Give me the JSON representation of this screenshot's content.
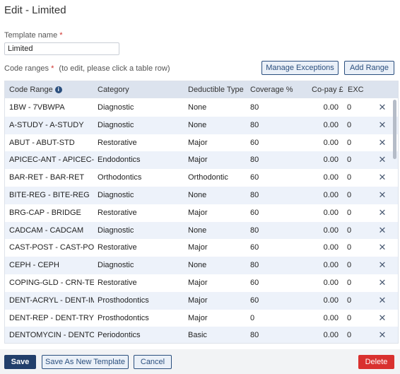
{
  "page": {
    "title": "Edit - Limited"
  },
  "template_name": {
    "label": "Template name",
    "required_mark": "*",
    "value": "Limited"
  },
  "code_ranges": {
    "label": "Code ranges",
    "required_mark": "*",
    "hint": "(to edit, please click a table row)",
    "manage_exceptions_label": "Manage Exceptions",
    "add_range_label": "Add Range"
  },
  "table": {
    "columns": {
      "code_range": "Code Range",
      "category": "Category",
      "deductible_type": "Deductible Type",
      "coverage": "Coverage %",
      "copay": "Co-pay £",
      "exc": "EXC"
    },
    "info_icon": "info-icon",
    "delete_icon": "close-icon",
    "rows": [
      {
        "code_range": "1BW - 7VBWPA",
        "category": "Diagnostic",
        "deductible_type": "None",
        "coverage": "80",
        "copay": "0.00",
        "exc": "0"
      },
      {
        "code_range": "A-STUDY - A-STUDY",
        "category": "Diagnostic",
        "deductible_type": "None",
        "coverage": "80",
        "copay": "0.00",
        "exc": "0"
      },
      {
        "code_range": "ABUT - ABUT-STD",
        "category": "Restorative",
        "deductible_type": "Major",
        "coverage": "60",
        "copay": "0.00",
        "exc": "0"
      },
      {
        "code_range": "APICEC-ANT - APICEC-...",
        "category": "Endodontics",
        "deductible_type": "Major",
        "coverage": "80",
        "copay": "0.00",
        "exc": "0"
      },
      {
        "code_range": "BAR-RET - BAR-RET",
        "category": "Orthodontics",
        "deductible_type": "Orthodontic",
        "coverage": "60",
        "copay": "0.00",
        "exc": "0"
      },
      {
        "code_range": "BITE-REG - BITE-REG",
        "category": "Diagnostic",
        "deductible_type": "None",
        "coverage": "80",
        "copay": "0.00",
        "exc": "0"
      },
      {
        "code_range": "BRG-CAP - BRIDGE",
        "category": "Restorative",
        "deductible_type": "Major",
        "coverage": "60",
        "copay": "0.00",
        "exc": "0"
      },
      {
        "code_range": "CADCAM - CADCAM",
        "category": "Diagnostic",
        "deductible_type": "None",
        "coverage": "80",
        "copay": "0.00",
        "exc": "0"
      },
      {
        "code_range": "CAST-POST - CAST-POST",
        "category": "Restorative",
        "deductible_type": "Major",
        "coverage": "60",
        "copay": "0.00",
        "exc": "0"
      },
      {
        "code_range": "CEPH - CEPH",
        "category": "Diagnostic",
        "deductible_type": "None",
        "coverage": "80",
        "copay": "0.00",
        "exc": "0"
      },
      {
        "code_range": "COPING-GLD - CRN-TEMP",
        "category": "Restorative",
        "deductible_type": "Major",
        "coverage": "60",
        "copay": "0.00",
        "exc": "0"
      },
      {
        "code_range": "DENT-ACRYL - DENT-IM...",
        "category": "Prosthodontics",
        "deductible_type": "Major",
        "coverage": "60",
        "copay": "0.00",
        "exc": "0"
      },
      {
        "code_range": "DENT-REP - DENT-TRY",
        "category": "Prosthodontics",
        "deductible_type": "Major",
        "coverage": "0",
        "copay": "0.00",
        "exc": "0"
      },
      {
        "code_range": "DENTOMYCIN - DENTO...",
        "category": "Periodontics",
        "deductible_type": "Basic",
        "coverage": "80",
        "copay": "0.00",
        "exc": "0"
      }
    ]
  },
  "footer": {
    "save_label": "Save",
    "save_as_new_label": "Save As New Template",
    "cancel_label": "Cancel",
    "delete_label": "Delete"
  },
  "colors": {
    "accent": "#2b4f7e",
    "header_bg": "#dce3ee",
    "row_alt_bg": "#edf2fa",
    "delete_red": "#d9312f"
  }
}
